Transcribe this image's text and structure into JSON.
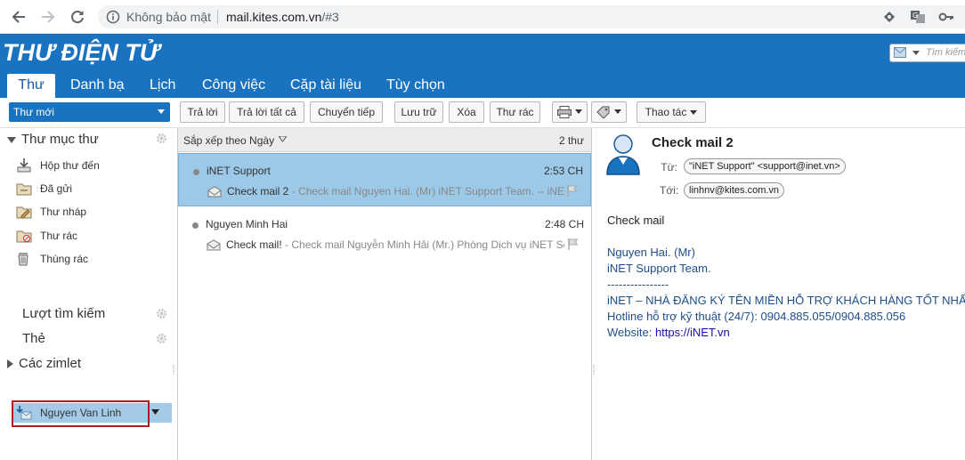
{
  "browser": {
    "security_label": "Không bảo mật",
    "url_host": "mail.kites.com.vn",
    "url_path": "/#3"
  },
  "app": {
    "title": "THƯ ĐIỆN TỬ",
    "search_placeholder": "Tìm kiếm",
    "brand_color": "#1a73c0"
  },
  "tabs": [
    {
      "label": "Thư",
      "active": true
    },
    {
      "label": "Danh bạ"
    },
    {
      "label": "Lịch"
    },
    {
      "label": "Công việc"
    },
    {
      "label": "Cặp tài liệu"
    },
    {
      "label": "Tùy chọn"
    }
  ],
  "toolbar": {
    "new_mail": "Thư mới",
    "reply": "Trả lời",
    "reply_all": "Trả lời tất cả",
    "forward": "Chuyển tiếp",
    "archive": "Lưu trữ",
    "delete": "Xóa",
    "spam": "Thư rác",
    "actions": "Thao tác"
  },
  "sidebar": {
    "folders_header": "Thư mục thư",
    "folders": [
      {
        "label": "Hộp thư đến",
        "icon": "inbox-icon"
      },
      {
        "label": "Đã gửi",
        "icon": "sent-icon"
      },
      {
        "label": "Thư nháp",
        "icon": "drafts-icon"
      },
      {
        "label": "Thư rác",
        "icon": "junk-icon"
      },
      {
        "label": "Thùng rác",
        "icon": "trash-icon"
      }
    ],
    "custom_folder": "Nguyen Van Linh",
    "searches_header": "Lượt tìm kiếm",
    "tags_header": "Thẻ",
    "zimlets_header": "Các zimlet"
  },
  "message_list": {
    "sort_label": "Sắp xếp theo Ngày",
    "count_label": "2 thư",
    "messages": [
      {
        "from": "iNET Support",
        "time": "2:53 CH",
        "subject": "Check mail 2",
        "fragment": " - Check mail Nguyen Hai. (Mr) iNET Support Team. -- iNET",
        "selected": true
      },
      {
        "from": "Nguyen Minh Hai",
        "time": "2:48 CH",
        "subject": "Check mail!",
        "fragment": " - Check mail Nguyễn Minh Hải (Mr.) Phòng Dịch vụ iNET Sc",
        "selected": false
      }
    ]
  },
  "reading": {
    "subject": "Check mail 2",
    "from_label": "Từ:",
    "from_value": "\"iNET Support\" <support@inet.vn>",
    "to_label": "Tới:",
    "to_value": "linhnv@kites.com.vn",
    "body": {
      "greeting": "Check mail",
      "sig_name": "Nguyen Hai. (Mr)",
      "sig_team": "iNET Support Team.",
      "divider": "----------------",
      "company": "iNET – NHÀ ĐĂNG KÝ TÊN MIỀN HỖ TRỢ KHÁCH HÀNG TỐT NHẤT",
      "hotline": "Hotline hỗ trợ kỹ thuật (24/7): 0904.885.055/0904.885.056",
      "website_label": "Website: ",
      "website_link": "https://iNET.vn"
    }
  }
}
